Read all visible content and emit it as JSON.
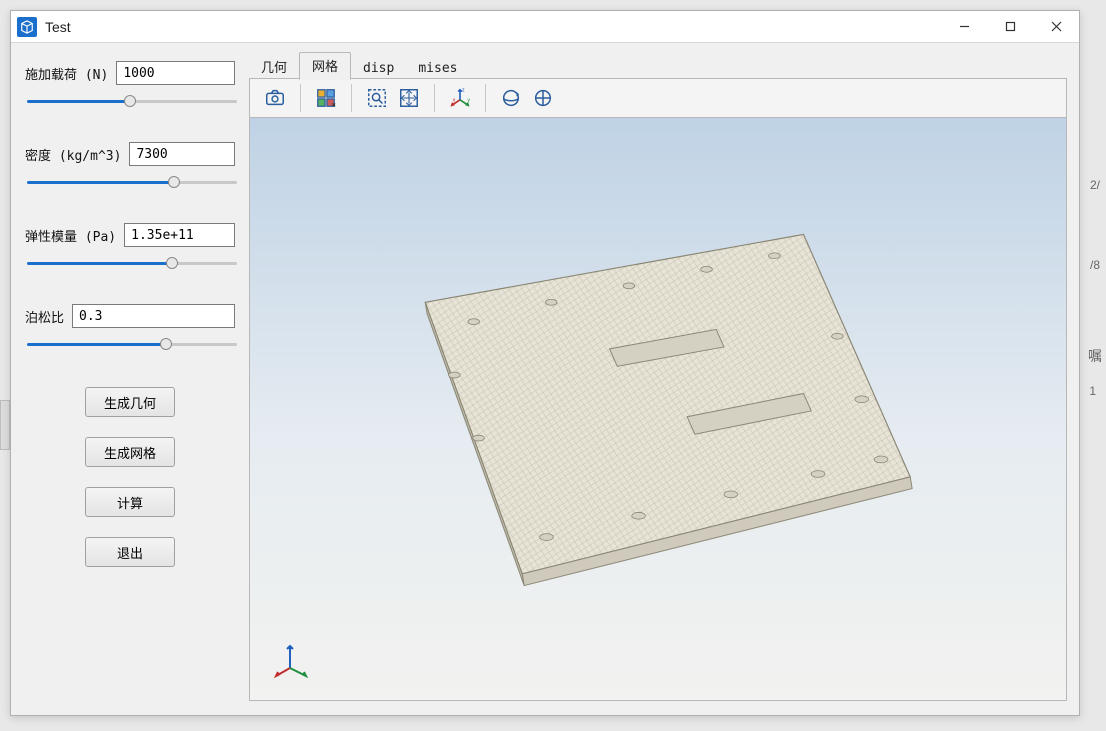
{
  "window": {
    "title": "Test"
  },
  "params": {
    "load": {
      "label": "施加载荷 (N)",
      "value": "1000",
      "slider_pct": 49
    },
    "density": {
      "label": "密度 (kg/m^3)",
      "value": "7300",
      "slider_pct": 71
    },
    "modulus": {
      "label": "弹性模量 (Pa)",
      "value": "1.35e+11",
      "slider_pct": 70
    },
    "poisson": {
      "label": "泊松比",
      "value": "0.3",
      "slider_pct": 67
    }
  },
  "buttons": {
    "gen_geometry": "生成几何",
    "gen_mesh": "生成网格",
    "compute": "计算",
    "exit": "退出"
  },
  "tabs": {
    "geometry": "几何",
    "mesh": "网格",
    "disp": "disp",
    "mises": "mises",
    "active": "mesh"
  },
  "toolbar": {
    "snapshot_icon": "camera-icon",
    "multiview_icon": "layout-icon",
    "zoom_area_icon": "zoom-area-icon",
    "fit_icon": "fit-extents-icon",
    "axes_icon": "axes-triad-icon",
    "orbit_icon": "orbit-icon",
    "pan_icon": "pan-orbit-icon"
  },
  "axes": {
    "x": "x",
    "y": "y",
    "z": "z"
  },
  "colors": {
    "accent": "#1a6ecc",
    "viewport_top": "#bfd2e5",
    "viewport_bottom": "#f2f2f0"
  },
  "bg_fragments": {
    "a": "2/",
    "b": "/8",
    "c": "嘱",
    "d": "1"
  }
}
